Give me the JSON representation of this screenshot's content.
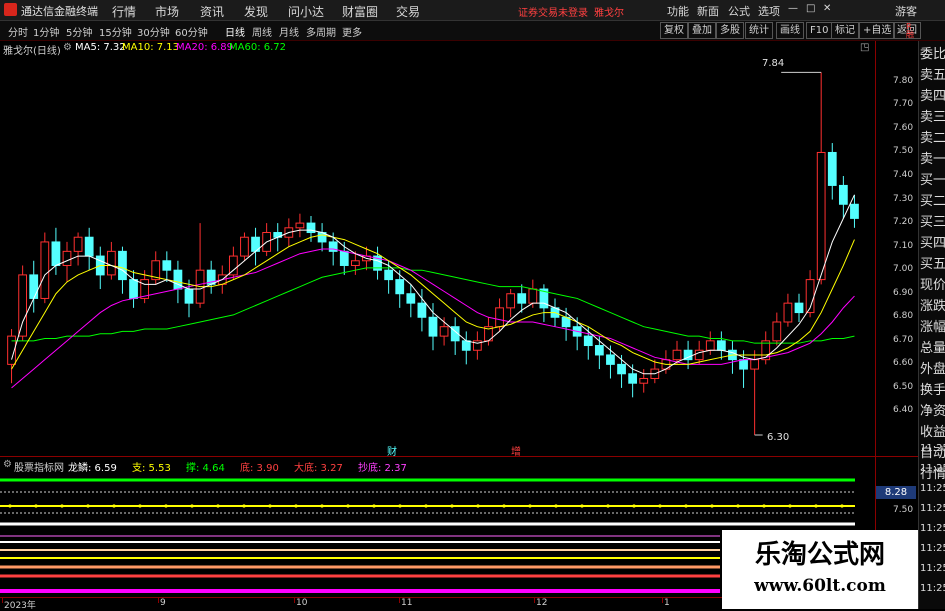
{
  "app": {
    "title": "通达信金融终端",
    "trade_status": "证券交易未登录",
    "stock": "雅戈尔"
  },
  "menu": [
    "行情",
    "市场",
    "资讯",
    "发现",
    "问小达",
    "财富圈",
    "交易"
  ],
  "titlebar_right": [
    "功能",
    "新面",
    "公式",
    "选项",
    "游客"
  ],
  "toolbar": {
    "periods": [
      "分时",
      "1分钟",
      "5分钟",
      "15分钟",
      "30分钟",
      "60分钟",
      "日线",
      "周线",
      "月线",
      "多周期",
      "更多"
    ],
    "active_period": "日线",
    "right_buttons": [
      "复权",
      "叠加",
      "多股",
      "统计",
      "画线",
      "F10",
      "标记",
      "+自选",
      "返回"
    ]
  },
  "chart_header": {
    "name": "雅戈尔(日线)",
    "ma5": "MA5: 7.32",
    "ma10": "MA10: 7.13",
    "ma20": "MA20: 6.89",
    "ma60": "MA60: 6.72"
  },
  "colors": {
    "up": "#ff3030",
    "down": "#54ffff",
    "ma5": "#ffffff",
    "ma10": "#ffff00",
    "ma20": "#ff00ff",
    "ma60": "#00ff00",
    "axis": "#8b0000"
  },
  "sidebar_items": [
    "委比",
    "卖五",
    "卖四",
    "卖三",
    "卖二",
    "卖一",
    "买一",
    "买二",
    "买三",
    "买四",
    "买五",
    "现价",
    "涨跌",
    "涨幅",
    "总量",
    "外盘",
    "换手",
    "净资",
    "收益",
    "自动",
    "行情"
  ],
  "time_labels": [
    "11:25",
    "11:25",
    "11:25",
    "11:25",
    "11:25",
    "11:25",
    "11:25",
    "11:25"
  ],
  "price_ticks": [
    "7.80",
    "7.70",
    "7.60",
    "7.50",
    "7.40",
    "7.30",
    "7.20",
    "7.10",
    "7.00",
    "6.90",
    "6.80",
    "6.70",
    "6.60",
    "6.50",
    "6.40"
  ],
  "annotations": {
    "high": "7.84",
    "low": "6.30",
    "event1": "财",
    "event2": "增"
  },
  "indicator": {
    "name": "股票指标网",
    "items": [
      {
        "label": "龙鳞:",
        "value": "6.59",
        "color": "#ffffff"
      },
      {
        "label": "支:",
        "value": "5.53",
        "color": "#ffff00"
      },
      {
        "label": "撑:",
        "value": "4.64",
        "color": "#00ff00"
      },
      {
        "label": "底:",
        "value": "3.90",
        "color": "#ff4040"
      },
      {
        "label": "大底:",
        "value": "3.27",
        "color": "#ff4040"
      },
      {
        "label": "抄底:",
        "value": "2.37",
        "color": "#ff40ff"
      }
    ],
    "axis_value": "8.28",
    "axis_value2": "7.50"
  },
  "x_axis": [
    "2023年",
    "9",
    "10",
    "11",
    "12",
    "1"
  ],
  "watermark": {
    "title": "乐淘公式网",
    "url": "www.60lt.com"
  },
  "chart_data": {
    "type": "candlestick",
    "ylim": [
      6.3,
      7.88
    ],
    "candles": [
      [
        6.6,
        6.72,
        6.52,
        6.75
      ],
      [
        6.72,
        6.98,
        6.7,
        7.02
      ],
      [
        6.98,
        6.88,
        6.82,
        7.04
      ],
      [
        6.88,
        7.12,
        6.86,
        7.16
      ],
      [
        7.12,
        7.02,
        6.98,
        7.18
      ],
      [
        7.02,
        7.08,
        6.95,
        7.12
      ],
      [
        7.08,
        7.14,
        7.02,
        7.16
      ],
      [
        7.14,
        7.06,
        7.0,
        7.18
      ],
      [
        7.06,
        6.98,
        6.92,
        7.1
      ],
      [
        6.98,
        7.08,
        6.96,
        7.12
      ],
      [
        7.08,
        6.96,
        6.9,
        7.1
      ],
      [
        6.96,
        6.88,
        6.84,
        7.0
      ],
      [
        6.88,
        6.96,
        6.86,
        7.0
      ],
      [
        6.96,
        7.04,
        6.94,
        7.08
      ],
      [
        7.04,
        7.0,
        6.95,
        7.08
      ],
      [
        7.0,
        6.92,
        6.86,
        7.04
      ],
      [
        6.92,
        6.86,
        6.8,
        6.96
      ],
      [
        6.86,
        7.0,
        6.84,
        7.2
      ],
      [
        7.0,
        6.94,
        6.9,
        7.04
      ],
      [
        6.94,
        6.98,
        6.9,
        7.02
      ],
      [
        6.98,
        7.06,
        6.96,
        7.1
      ],
      [
        7.06,
        7.14,
        7.04,
        7.16
      ],
      [
        7.14,
        7.08,
        7.02,
        7.18
      ],
      [
        7.08,
        7.16,
        7.06,
        7.2
      ],
      [
        7.16,
        7.14,
        7.08,
        7.2
      ],
      [
        7.14,
        7.18,
        7.1,
        7.22
      ],
      [
        7.18,
        7.2,
        7.14,
        7.24
      ],
      [
        7.2,
        7.16,
        7.12,
        7.23
      ],
      [
        7.16,
        7.12,
        7.08,
        7.2
      ],
      [
        7.12,
        7.08,
        7.02,
        7.16
      ],
      [
        7.08,
        7.02,
        6.98,
        7.12
      ],
      [
        7.02,
        7.04,
        6.98,
        7.08
      ],
      [
        7.04,
        7.06,
        7.0,
        7.1
      ],
      [
        7.06,
        7.0,
        6.96,
        7.1
      ],
      [
        7.0,
        6.96,
        6.9,
        7.04
      ],
      [
        6.96,
        6.9,
        6.84,
        7.0
      ],
      [
        6.9,
        6.86,
        6.8,
        6.94
      ],
      [
        6.86,
        6.8,
        6.74,
        6.92
      ],
      [
        6.8,
        6.72,
        6.66,
        6.86
      ],
      [
        6.72,
        6.76,
        6.68,
        6.8
      ],
      [
        6.76,
        6.7,
        6.64,
        6.8
      ],
      [
        6.7,
        6.66,
        6.6,
        6.74
      ],
      [
        6.66,
        6.7,
        6.62,
        6.74
      ],
      [
        6.7,
        6.76,
        6.68,
        6.8
      ],
      [
        6.76,
        6.84,
        6.74,
        6.88
      ],
      [
        6.84,
        6.9,
        6.8,
        6.92
      ],
      [
        6.9,
        6.86,
        6.82,
        6.94
      ],
      [
        6.86,
        6.92,
        6.84,
        6.96
      ],
      [
        6.92,
        6.84,
        6.78,
        6.94
      ],
      [
        6.84,
        6.8,
        6.76,
        6.88
      ],
      [
        6.8,
        6.76,
        6.7,
        6.84
      ],
      [
        6.76,
        6.72,
        6.66,
        6.8
      ],
      [
        6.72,
        6.68,
        6.62,
        6.76
      ],
      [
        6.68,
        6.64,
        6.58,
        6.72
      ],
      [
        6.64,
        6.6,
        6.54,
        6.68
      ],
      [
        6.6,
        6.56,
        6.5,
        6.64
      ],
      [
        6.56,
        6.52,
        6.46,
        6.6
      ],
      [
        6.52,
        6.54,
        6.48,
        6.58
      ],
      [
        6.54,
        6.58,
        6.52,
        6.62
      ],
      [
        6.58,
        6.62,
        6.56,
        6.66
      ],
      [
        6.62,
        6.66,
        6.6,
        6.7
      ],
      [
        6.66,
        6.62,
        6.58,
        6.7
      ],
      [
        6.62,
        6.66,
        6.6,
        6.7
      ],
      [
        6.66,
        6.7,
        6.64,
        6.74
      ],
      [
        6.7,
        6.66,
        6.62,
        6.74
      ],
      [
        6.66,
        6.62,
        6.56,
        6.7
      ],
      [
        6.62,
        6.58,
        6.5,
        6.66
      ],
      [
        6.58,
        6.62,
        6.3,
        6.66
      ],
      [
        6.62,
        6.7,
        6.6,
        6.74
      ],
      [
        6.7,
        6.78,
        6.68,
        6.82
      ],
      [
        6.78,
        6.86,
        6.76,
        6.9
      ],
      [
        6.86,
        6.82,
        6.78,
        6.9
      ],
      [
        6.82,
        6.96,
        6.8,
        7.0
      ],
      [
        6.96,
        7.5,
        6.94,
        7.84
      ],
      [
        7.5,
        7.36,
        7.3,
        7.54
      ],
      [
        7.36,
        7.28,
        7.22,
        7.4
      ],
      [
        7.28,
        7.22,
        7.18,
        7.32
      ]
    ],
    "ma5": [
      6.62,
      6.78,
      6.88,
      6.98,
      7.02,
      7.04,
      7.06,
      7.06,
      7.04,
      7.02,
      7.0,
      6.96,
      6.94,
      6.94,
      6.96,
      6.94,
      6.92,
      6.92,
      6.94,
      6.96,
      7.0,
      7.04,
      7.08,
      7.12,
      7.14,
      7.16,
      7.17,
      7.17,
      7.16,
      7.14,
      7.1,
      7.07,
      7.05,
      7.04,
      7.02,
      6.98,
      6.94,
      6.88,
      6.82,
      6.78,
      6.74,
      6.7,
      6.69,
      6.7,
      6.74,
      6.79,
      6.83,
      6.86,
      6.86,
      6.84,
      6.82,
      6.78,
      6.74,
      6.7,
      6.66,
      6.62,
      6.58,
      6.56,
      6.56,
      6.58,
      6.61,
      6.63,
      6.65,
      6.66,
      6.66,
      6.65,
      6.63,
      6.62,
      6.63,
      6.67,
      6.72,
      6.77,
      6.84,
      6.98,
      7.12,
      7.22,
      7.32
    ],
    "ma10": [
      6.58,
      6.66,
      6.74,
      6.82,
      6.9,
      6.95,
      6.98,
      7.0,
      7.02,
      7.02,
      7.01,
      6.99,
      6.98,
      6.97,
      6.96,
      6.95,
      6.94,
      6.93,
      6.93,
      6.94,
      6.96,
      6.98,
      7.01,
      7.04,
      7.07,
      7.1,
      7.12,
      7.14,
      7.15,
      7.14,
      7.13,
      7.11,
      7.09,
      7.07,
      7.04,
      7.01,
      6.98,
      6.94,
      6.9,
      6.86,
      6.82,
      6.78,
      6.76,
      6.75,
      6.76,
      6.77,
      6.79,
      6.81,
      6.82,
      6.82,
      6.8,
      6.78,
      6.76,
      6.73,
      6.7,
      6.68,
      6.65,
      6.63,
      6.61,
      6.6,
      6.6,
      6.6,
      6.61,
      6.62,
      6.63,
      6.64,
      6.64,
      6.64,
      6.64,
      6.65,
      6.67,
      6.7,
      6.74,
      6.82,
      6.92,
      7.02,
      7.13
    ],
    "ma20": [
      6.5,
      6.54,
      6.58,
      6.62,
      6.66,
      6.7,
      6.74,
      6.78,
      6.82,
      6.85,
      6.87,
      6.88,
      6.89,
      6.9,
      6.91,
      6.92,
      6.93,
      6.94,
      6.95,
      6.96,
      6.97,
      6.98,
      6.99,
      7.01,
      7.03,
      7.05,
      7.07,
      7.08,
      7.09,
      7.09,
      7.08,
      7.07,
      7.06,
      7.05,
      7.04,
      7.02,
      7.0,
      6.97,
      6.94,
      6.91,
      6.88,
      6.85,
      6.82,
      6.8,
      6.79,
      6.78,
      6.78,
      6.78,
      6.77,
      6.76,
      6.75,
      6.74,
      6.73,
      6.72,
      6.71,
      6.69,
      6.67,
      6.65,
      6.63,
      6.62,
      6.61,
      6.6,
      6.6,
      6.6,
      6.6,
      6.61,
      6.62,
      6.62,
      6.63,
      6.64,
      6.65,
      6.67,
      6.69,
      6.73,
      6.78,
      6.84,
      6.89
    ],
    "ma60": [
      6.7,
      6.7,
      6.7,
      6.71,
      6.71,
      6.72,
      6.72,
      6.72,
      6.73,
      6.73,
      6.74,
      6.74,
      6.75,
      6.75,
      6.75,
      6.76,
      6.77,
      6.78,
      6.79,
      6.8,
      6.81,
      6.83,
      6.85,
      6.87,
      6.89,
      6.91,
      6.93,
      6.95,
      6.97,
      6.98,
      6.99,
      7.0,
      7.01,
      7.01,
      7.01,
      7.01,
      7.0,
      7.0,
      6.99,
      6.98,
      6.97,
      6.96,
      6.95,
      6.94,
      6.93,
      6.93,
      6.93,
      6.92,
      6.91,
      6.9,
      6.89,
      6.88,
      6.86,
      6.84,
      6.82,
      6.8,
      6.78,
      6.76,
      6.75,
      6.74,
      6.73,
      6.72,
      6.72,
      6.71,
      6.71,
      6.7,
      6.7,
      6.69,
      6.69,
      6.69,
      6.69,
      6.69,
      6.7,
      6.7,
      6.71,
      6.71,
      6.72
    ]
  }
}
